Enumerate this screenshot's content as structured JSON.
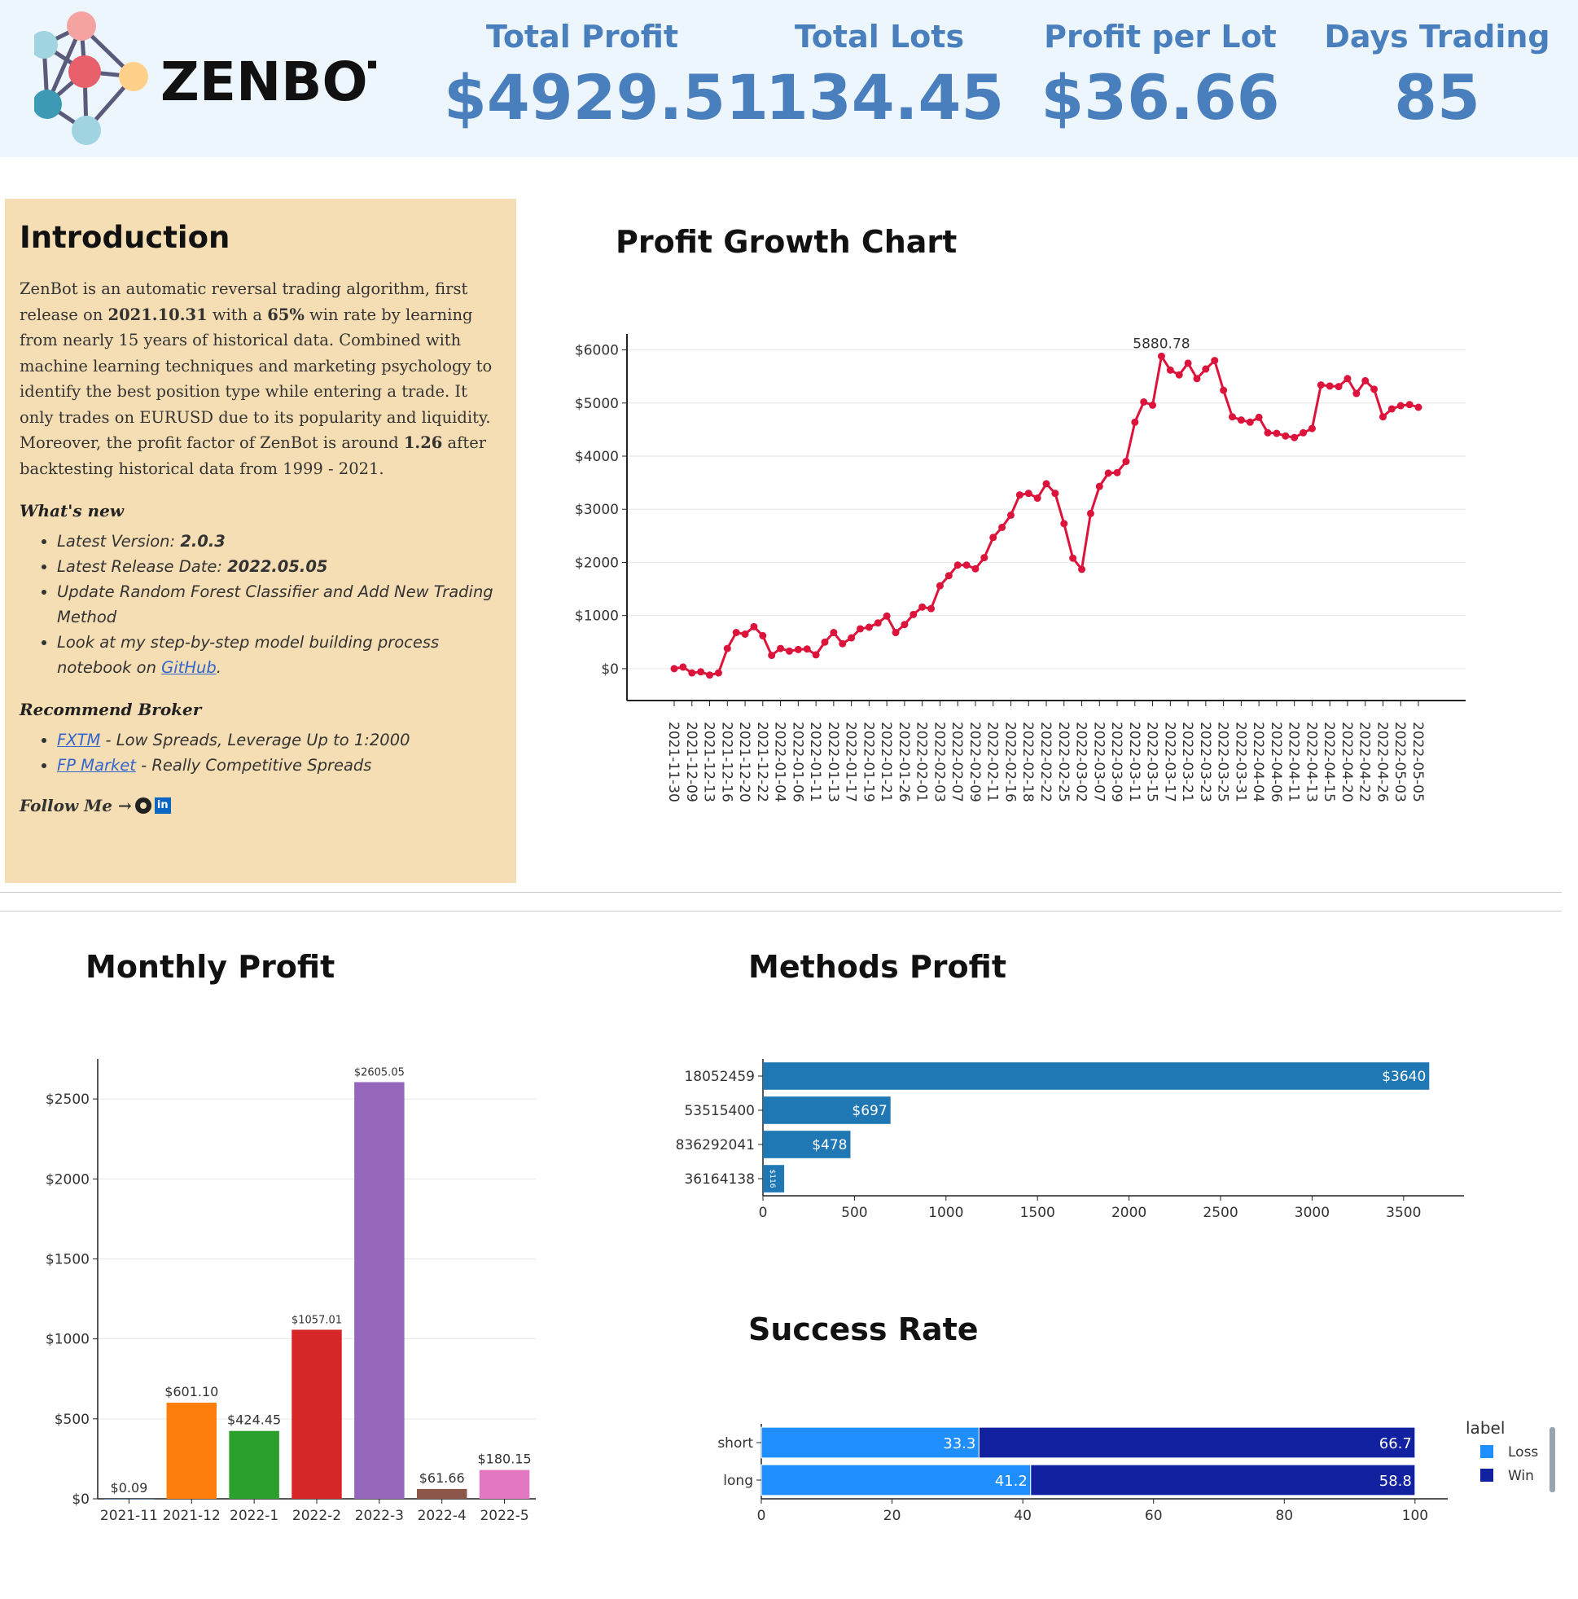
{
  "app": {
    "name": "ZENBOT"
  },
  "stats": [
    {
      "label": "Total Profit",
      "value": "$4929.51"
    },
    {
      "label": "Total Lots",
      "value": "134.45"
    },
    {
      "label": "Profit per Lot",
      "value": "$36.66"
    },
    {
      "label": "Days Trading",
      "value": "85"
    }
  ],
  "intro": {
    "title": "Introduction",
    "p1_a": "ZenBot is an automatic reversal trading algorithm, first release on ",
    "p1_date": "2021.10.31",
    "p1_b": " with a ",
    "p1_rate": "65%",
    "p1_c": " win rate by learning from nearly 15 years of historical data. Combined with machine learning techniques and marketing psychology to identify the best position type while entering a trade. It only trades on EURUSD due to its popularity and liquidity. Moreover, the profit factor of ZenBot is around ",
    "p1_pf": "1.26",
    "p1_d": " after backtesting historical data from 1999 - 2021.",
    "whats_new_title": "What's new",
    "whats_new": {
      "version_label": "Latest Version: ",
      "version": "2.0.3",
      "release_label": "Latest Release Date: ",
      "release": "2022.05.05",
      "update": "Update Random Forest Classifier and Add New Trading Method",
      "look_a": "Look at my step-by-step model building process notebook on ",
      "look_link": "GitHub",
      "look_b": "."
    },
    "broker_title": "Recommend Broker",
    "brokers": [
      {
        "name": "FXTM",
        "desc": " - Low Spreads, Leverage Up to 1:2000"
      },
      {
        "name": "FP Market",
        "desc": " - Really Competitive Spreads"
      }
    ],
    "follow": "Follow Me →"
  },
  "titles": {
    "growth": "Profit Growth Chart",
    "monthly": "Monthly Profit",
    "methods": "Methods Profit",
    "success": "Success Rate"
  },
  "chart_data": [
    {
      "id": "growth",
      "type": "line",
      "title": "Profit Growth Chart",
      "color": "#dc143c",
      "ylim": [
        -600,
        6300
      ],
      "yticks": [
        0,
        1000,
        2000,
        3000,
        4000,
        5000,
        6000
      ],
      "ytick_labels": [
        "$0",
        "$1000",
        "$2000",
        "$3000",
        "$4000",
        "$5000",
        "$6000"
      ],
      "xtick_labels": [
        "2021-11-30",
        "2021-12-09",
        "2021-12-13",
        "2021-12-16",
        "2021-12-20",
        "2021-12-22",
        "2022-01-04",
        "2022-01-06",
        "2022-01-11",
        "2022-01-13",
        "2022-01-17",
        "2022-01-19",
        "2022-01-21",
        "2022-01-26",
        "2022-02-01",
        "2022-02-03",
        "2022-02-07",
        "2022-02-09",
        "2022-02-11",
        "2022-02-16",
        "2022-02-18",
        "2022-02-22",
        "2022-02-25",
        "2022-03-02",
        "2022-03-07",
        "2022-03-09",
        "2022-03-11",
        "2022-03-15",
        "2022-03-17",
        "2022-03-21",
        "2022-03-23",
        "2022-03-25",
        "2022-03-31",
        "2022-04-04",
        "2022-04-06",
        "2022-04-11",
        "2022-04-13",
        "2022-04-15",
        "2022-04-20",
        "2022-04-22",
        "2022-04-26",
        "2022-05-03",
        "2022-05-05"
      ],
      "annotation": "5880.78",
      "values": [
        0,
        30,
        -80,
        -60,
        -120,
        -80,
        380,
        680,
        650,
        790,
        620,
        250,
        380,
        330,
        360,
        370,
        260,
        500,
        680,
        470,
        580,
        750,
        780,
        860,
        990,
        680,
        830,
        1020,
        1160,
        1130,
        1560,
        1750,
        1950,
        1950,
        1880,
        2090,
        2470,
        2660,
        2890,
        3270,
        3300,
        3210,
        3480,
        3300,
        2730,
        2080,
        1870,
        2920,
        3430,
        3680,
        3690,
        3900,
        4640,
        5020,
        4960,
        5880.78,
        5620,
        5530,
        5750,
        5460,
        5640,
        5800,
        5240,
        4740,
        4680,
        4640,
        4730,
        4440,
        4430,
        4380,
        4350,
        4440,
        4520,
        5340,
        5320,
        5310,
        5460,
        5180,
        5420,
        5260,
        4740,
        4890,
        4950,
        4970,
        4920
      ]
    },
    {
      "id": "monthly",
      "type": "bar",
      "title": "Monthly Profit",
      "categories": [
        "2021-11",
        "2021-12",
        "2022-1",
        "2022-2",
        "2022-3",
        "2022-4",
        "2022-5"
      ],
      "values": [
        0.09,
        601.1,
        424.45,
        1057.01,
        2605.05,
        61.66,
        180.15
      ],
      "labels": [
        "$0.09",
        "$601.10",
        "$424.45",
        "$1057.01",
        "$2605.05",
        "$61.66",
        "$180.15"
      ],
      "colors": [
        "#1f77b4",
        "#ff7f0e",
        "#2ca02c",
        "#d62728",
        "#9467bd",
        "#8c564b",
        "#e377c2"
      ],
      "ylim": [
        0,
        2750
      ],
      "yticks": [
        0,
        500,
        1000,
        1500,
        2000,
        2500
      ],
      "ytick_labels": [
        "$0",
        "$500",
        "$1000",
        "$1500",
        "$2000",
        "$2500"
      ]
    },
    {
      "id": "methods",
      "type": "bar",
      "orientation": "horizontal",
      "title": "Methods Profit",
      "categories": [
        "18052459",
        "53515400",
        "836292041",
        "36164138"
      ],
      "values": [
        3640,
        697,
        478,
        116
      ],
      "labels": [
        "$3640",
        "$697",
        "$478",
        "$116"
      ],
      "color": "#1f77b4",
      "xlim": [
        0,
        3830
      ],
      "xticks": [
        0,
        500,
        1000,
        1500,
        2000,
        2500,
        3000,
        3500
      ]
    },
    {
      "id": "success",
      "type": "bar",
      "orientation": "horizontal",
      "stacked": true,
      "title": "Success Rate",
      "categories": [
        "short",
        "long"
      ],
      "series": [
        {
          "name": "Loss",
          "color": "#1f8fff",
          "values": [
            33.3,
            41.2
          ]
        },
        {
          "name": "Win",
          "color": "#1221a0",
          "values": [
            66.7,
            58.8
          ]
        }
      ],
      "xlim": [
        0,
        105
      ],
      "xticks": [
        0,
        20,
        40,
        60,
        80,
        100
      ],
      "legend_title": "label",
      "legend_position": "right"
    }
  ]
}
